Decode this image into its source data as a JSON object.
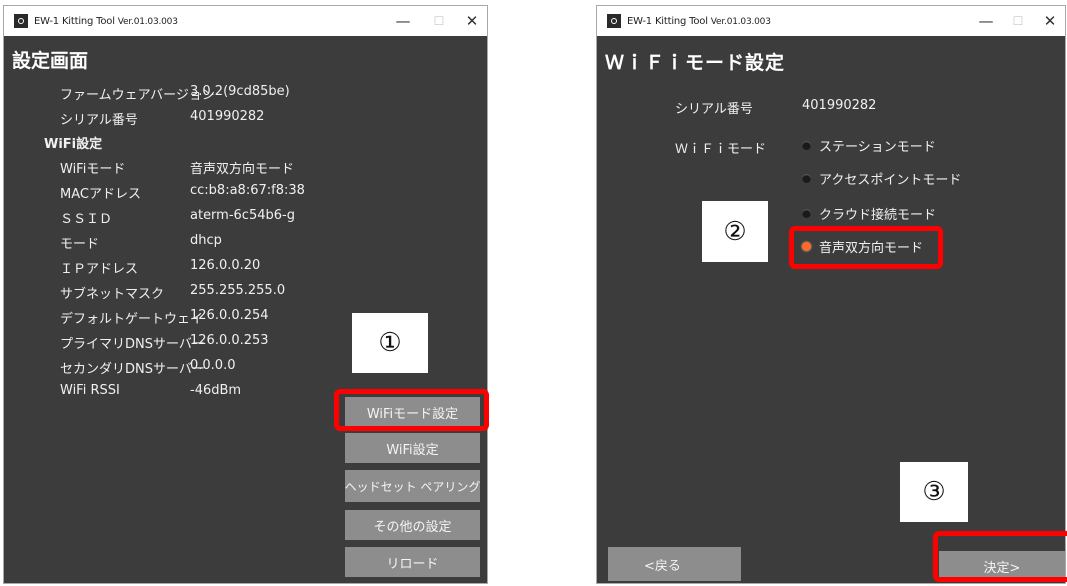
{
  "left": {
    "title_app": "EW-1 Kitting Tool",
    "title_ver": "Ver.01.03.003",
    "controls": {
      "minimize": "—",
      "maximize": "☐",
      "close": "✕"
    },
    "screen_title": "設定画面",
    "fields": [
      {
        "label": "ファームウェアバージョン",
        "value": "3.0.2(9cd85be)"
      },
      {
        "label": "シリアル番号",
        "value": "401990282"
      }
    ],
    "wifi_section": "WiFi設定",
    "wifi_fields": [
      {
        "label": "WiFiモード",
        "value": "音声双方向モード"
      },
      {
        "label": "MACアドレス",
        "value": "cc:b8:a8:67:f8:38"
      },
      {
        "label": "ＳＳＩＤ",
        "value": "aterm-6c54b6-g"
      },
      {
        "label": "モード",
        "value": "dhcp"
      },
      {
        "label": "ＩＰアドレス",
        "value": "126.0.0.20"
      },
      {
        "label": "サブネットマスク",
        "value": "255.255.255.0"
      },
      {
        "label": "デフォルトゲートウェイ",
        "value": "126.0.0.254"
      },
      {
        "label": "プライマリDNSサーバー",
        "value": "126.0.0.253"
      },
      {
        "label": "セカンダリDNSサーバー",
        "value": "0.0.0.0"
      },
      {
        "label": "WiFi RSSI",
        "value": "-46dBm"
      }
    ],
    "buttons": {
      "wifi_mode": "WiFiモード設定",
      "wifi_settings": "WiFi設定",
      "headset_pairing": "ヘッドセット ペアリング",
      "other_settings": "その他の設定",
      "reload": "リロード"
    },
    "callout": "①"
  },
  "right": {
    "title_app": "EW-1 Kitting Tool",
    "title_ver": "Ver.01.03.003",
    "controls": {
      "minimize": "—",
      "maximize": "☐",
      "close": "✕"
    },
    "screen_title": "ＷｉＦｉモード設定",
    "serial_label": "シリアル番号",
    "serial_value": "401990282",
    "mode_label": "ＷｉＦｉモード",
    "options": [
      {
        "label": "ステーションモード",
        "selected": false
      },
      {
        "label": "アクセスポイントモード",
        "selected": false
      },
      {
        "label": "クラウド接続モード",
        "selected": false
      },
      {
        "label": "音声双方向モード",
        "selected": true
      }
    ],
    "buttons": {
      "back": "<戻る",
      "confirm": "決定>"
    },
    "callout_2": "②",
    "callout_3": "③"
  },
  "colors": {
    "window_bg": "#3c3c3c",
    "button_bg": "#8d8d8d",
    "highlight_red": "#ff0000",
    "radio_selected": "#ff6a2a"
  }
}
